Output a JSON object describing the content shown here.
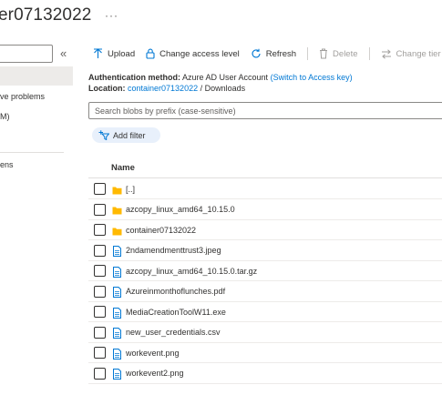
{
  "header": {
    "title": "er07132022",
    "more_label": "···"
  },
  "nav": {
    "collapse_label": "«",
    "items": [
      {
        "label": "ve problems"
      },
      {
        "label": "M)"
      },
      {
        "label": "ens"
      }
    ]
  },
  "toolbar": {
    "upload": "Upload",
    "change_access": "Change access level",
    "refresh": "Refresh",
    "delete": "Delete",
    "change_tier": "Change tier"
  },
  "auth": {
    "label": "Authentication method:",
    "value": "Azure AD User Account",
    "link": "(Switch to Access key)"
  },
  "location": {
    "label": "Location:",
    "container": "container07132022",
    "sep": "/",
    "folder": "Downloads"
  },
  "search": {
    "placeholder": "Search blobs by prefix (case-sensitive)"
  },
  "filter": {
    "label": "Add filter"
  },
  "table": {
    "header": "Name",
    "rows": [
      {
        "name": "[..]",
        "type": "folder"
      },
      {
        "name": "azcopy_linux_amd64_10.15.0",
        "type": "folder"
      },
      {
        "name": "container07132022",
        "type": "folder"
      },
      {
        "name": "2ndamendmenttrust3.jpeg",
        "type": "file"
      },
      {
        "name": "azcopy_linux_amd64_10.15.0.tar.gz",
        "type": "file"
      },
      {
        "name": "Azureinmonthoflunches.pdf",
        "type": "file"
      },
      {
        "name": "MediaCreationToolW11.exe",
        "type": "file"
      },
      {
        "name": "new_user_credentials.csv",
        "type": "file"
      },
      {
        "name": "workevent.png",
        "type": "file"
      },
      {
        "name": "workevent2.png",
        "type": "file"
      }
    ]
  },
  "colors": {
    "accent": "#0078d4",
    "folder": "#ffb900",
    "file_outline": "#0078d4",
    "selected_nav": "#edebe9"
  }
}
